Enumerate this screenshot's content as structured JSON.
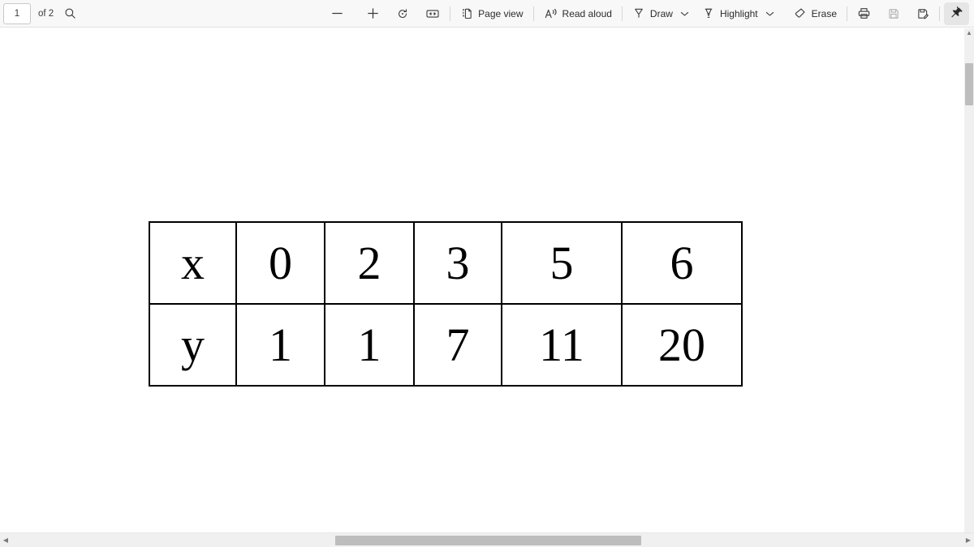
{
  "toolbar": {
    "page_current": "1",
    "page_total_label": "of 2",
    "search_icon": "search-icon",
    "zoom_out_label": "Zoom out",
    "zoom_in_label": "Zoom in",
    "rotate_label": "Rotate",
    "fit_page_label": "Fit to page",
    "page_view_label": "Page view",
    "page_view_icon": "page-view-icon",
    "read_aloud_label": "Read aloud",
    "read_aloud_icon": "read-aloud-icon",
    "draw_label": "Draw",
    "draw_icon": "draw-pen-icon",
    "draw_chevron": "chevron-down-icon",
    "highlight_label": "Highlight",
    "highlight_icon": "highlighter-icon",
    "highlight_chevron": "chevron-down-icon",
    "erase_label": "Erase",
    "erase_icon": "eraser-icon",
    "print_label": "Print",
    "save_label": "Save",
    "save_as_label": "Save as",
    "pin_label": "Pin toolbar"
  },
  "document": {
    "table": {
      "rows": [
        {
          "label": "x",
          "values": [
            "0",
            "2",
            "3",
            "5",
            "6"
          ]
        },
        {
          "label": "y",
          "values": [
            "1",
            "1",
            "7",
            "11",
            "20"
          ]
        }
      ]
    }
  },
  "scrollbars": {
    "vertical_up_arrow": "▲",
    "horizontal_left_arrow": "◀",
    "horizontal_right_arrow": "▶"
  },
  "colors": {
    "toolbar_bg": "#f8f8f8",
    "toolbar_border": "#e2e2e2",
    "pinned_bg": "#e6e6e6",
    "scroll_thumb": "#bdbdbd",
    "text": "#2b2b2b",
    "table_border": "#000000"
  }
}
